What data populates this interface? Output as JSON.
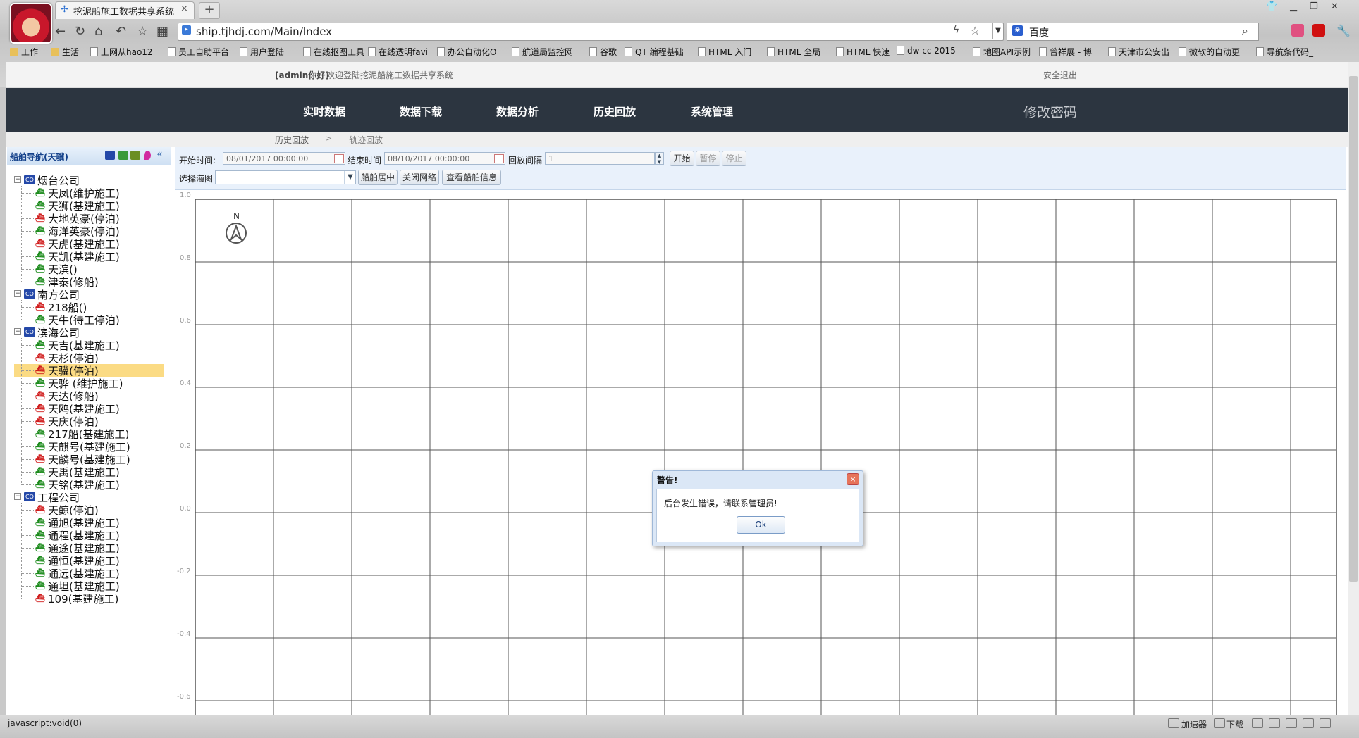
{
  "browser": {
    "tab_title": "挖泥船施工数据共享系统",
    "tab_close": "×",
    "new_tab": "+",
    "address": "ship.tjhdj.com/Main/Index",
    "search_engine": "百度",
    "bookmarks": [
      "工作",
      "生活",
      "上网从hao12",
      "员工自助平台",
      "用户登陆",
      "在线抠图工具",
      "在线透明favi",
      "办公自动化O",
      "航道局监控网",
      "谷歌",
      "QT 编程基础",
      "HTML 入门",
      "HTML 全局",
      "HTML 快速",
      "dw cc 2015",
      "地图API示例",
      "曾祥展 - 博",
      "天津市公安出",
      "微软的自动更",
      "导航条代码_"
    ],
    "status_text": "javascript:void(0)",
    "status_accel": "加速器",
    "status_download": "下载"
  },
  "header": {
    "user": "[admin你好]",
    "welcome": "欢迎登陆挖泥船施工数据共享系统",
    "logout": "安全退出"
  },
  "nav": {
    "items": [
      "实时数据",
      "数据下载",
      "数据分析",
      "历史回放",
      "系统管理"
    ],
    "change_password": "修改密码"
  },
  "breadcrumb": {
    "level1": "历史回放",
    "sep": ">",
    "level2": "轨迹回放"
  },
  "sidebar": {
    "title": "船舶导航(天骥)",
    "collapse": "«",
    "companies": [
      {
        "name": "烟台公司",
        "ships": [
          {
            "label": "天凤(维护施工)",
            "status": "green"
          },
          {
            "label": "天狮(基建施工)",
            "status": "green"
          },
          {
            "label": "大地英豪(停泊)",
            "status": "red"
          },
          {
            "label": "海洋英豪(停泊)",
            "status": "green"
          },
          {
            "label": "天虎(基建施工)",
            "status": "red"
          },
          {
            "label": "天凯(基建施工)",
            "status": "green"
          },
          {
            "label": "天滨()",
            "status": "green"
          },
          {
            "label": "津泰(修船)",
            "status": "green"
          }
        ]
      },
      {
        "name": "南方公司",
        "ships": [
          {
            "label": "218船()",
            "status": "red"
          },
          {
            "label": "天牛(待工停泊)",
            "status": "green"
          }
        ]
      },
      {
        "name": "滨海公司",
        "ships": [
          {
            "label": "天吉(基建施工)",
            "status": "green"
          },
          {
            "label": "天杉(停泊)",
            "status": "red"
          },
          {
            "label": "天骥(停泊)",
            "status": "red",
            "selected": true
          },
          {
            "label": "天骅 (维护施工)",
            "status": "green"
          },
          {
            "label": "天达(修船)",
            "status": "red"
          },
          {
            "label": "天鸥(基建施工)",
            "status": "red"
          },
          {
            "label": "天庆(停泊)",
            "status": "red"
          },
          {
            "label": "217船(基建施工)",
            "status": "green"
          },
          {
            "label": "天麒号(基建施工)",
            "status": "green"
          },
          {
            "label": "天麟号(基建施工)",
            "status": "red"
          },
          {
            "label": "天禹(基建施工)",
            "status": "green"
          },
          {
            "label": "天铭(基建施工)",
            "status": "green"
          }
        ]
      },
      {
        "name": "工程公司",
        "ships": [
          {
            "label": "天鲸(停泊)",
            "status": "red"
          },
          {
            "label": "通旭(基建施工)",
            "status": "green"
          },
          {
            "label": "通程(基建施工)",
            "status": "green"
          },
          {
            "label": "通途(基建施工)",
            "status": "green"
          },
          {
            "label": "通恒(基建施工)",
            "status": "green"
          },
          {
            "label": "通远(基建施工)",
            "status": "green"
          },
          {
            "label": "通坦(基建施工)",
            "status": "green"
          },
          {
            "label": "109(基建施工)",
            "status": "red"
          }
        ]
      }
    ]
  },
  "toolbar": {
    "start_label": "开始时间:",
    "start_value": "08/01/2017 00:00:00",
    "end_label": "结束时间",
    "end_value": "08/10/2017 00:00:00",
    "interval_label": "回放间隔",
    "interval_value": "1",
    "start_btn": "开始",
    "pause_btn": "暂停",
    "stop_btn": "停止",
    "chart_label": "选择海图",
    "center_btn": "船舶居中",
    "close_net_btn": "关闭网络",
    "info_btn": "查看船舶信息"
  },
  "map": {
    "north": "N",
    "y_ticks": [
      "1.0",
      "0.8",
      "0.6",
      "0.4",
      "0.2",
      "0.0",
      "-0.2",
      "-0.4",
      "-0.6"
    ]
  },
  "dialog": {
    "title": "警告!",
    "close": "×",
    "message": "后台发生错误，请联系管理员!",
    "ok": "Ok"
  },
  "colors": {
    "nav_bg": "#2c3540",
    "selected_row": "#fbdb84",
    "ship_green": "#1a8a1a",
    "ship_red": "#d01a1a"
  }
}
